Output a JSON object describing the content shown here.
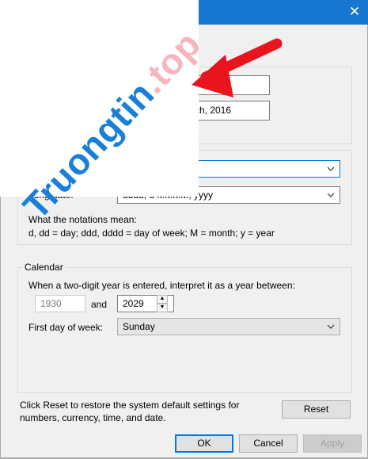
{
  "window": {
    "close_glyph": "✕"
  },
  "time_group": {
    "box1_value": "",
    "box2_value": "rch, 2016"
  },
  "date_group": {
    "short_date_value": "",
    "long_date_label": "Long date:",
    "long_date_value": "dddd, d MMMM, yyyy",
    "notations_heading": "What the notations mean:",
    "notations_text": "d, dd = day;  ddd, dddd = day of week;  M = month;  y = year"
  },
  "calendar": {
    "group_label": "Calendar",
    "two_digit_prompt": "When a two-digit year is entered, interpret it as a year between:",
    "year_from": "1930",
    "and_label": "and",
    "year_to": "2029",
    "first_day_label": "First day of week:",
    "first_day_value": "Sunday"
  },
  "reset": {
    "description": "Click Reset to restore the system default settings for numbers, currency, time, and date.",
    "button_label": "Reset"
  },
  "footer": {
    "ok_label": "OK",
    "cancel_label": "Cancel",
    "apply_label": "Apply"
  },
  "watermark": {
    "text_main": "Truongtin",
    "text_suffix": ".top"
  },
  "colors": {
    "accent": "#0078d7",
    "titlebar": "#1777d0",
    "watermark_blue": "#1b7fd8",
    "arrow_red": "#e8141e"
  },
  "icons": [
    "close-icon",
    "chevron-down-icon",
    "spin-up-icon",
    "spin-down-icon",
    "red-arrow-annotation"
  ]
}
